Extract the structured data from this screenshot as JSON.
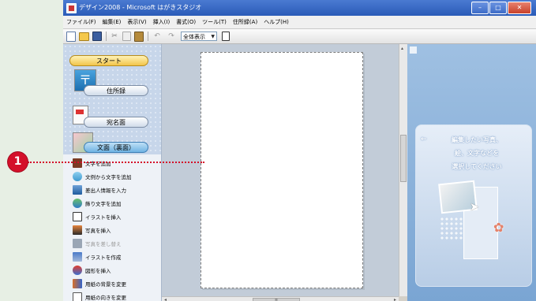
{
  "window": {
    "title": "デザイン2008 - Microsoft はがきスタジオ",
    "controls": {
      "minimize": "–",
      "maximize": "□",
      "close": "✕"
    }
  },
  "menubar": {
    "items": [
      "ファイル(F)",
      "編集(E)",
      "表示(V)",
      "挿入(I)",
      "書式(O)",
      "ツール(T)",
      "住所録(A)",
      "ヘルプ(H)"
    ]
  },
  "toolbar": {
    "zoom_value": "全体表示",
    "icons": [
      "new-icon",
      "open-icon",
      "save-icon",
      "cut-icon",
      "copy-icon",
      "paste-icon",
      "undo-icon",
      "redo-icon",
      "page-icon"
    ]
  },
  "sidebar": {
    "nav": {
      "start": "スタート",
      "address_book": "住所録",
      "recipient": "宛名面",
      "front": "文面（裏面）"
    },
    "tasks": [
      {
        "label": "文字を追加",
        "enabled": true
      },
      {
        "label": "文例から文字を追加",
        "enabled": true
      },
      {
        "label": "差出人情報を入力",
        "enabled": true
      },
      {
        "label": "飾り文字を追加",
        "enabled": true
      },
      {
        "label": "イラストを挿入",
        "enabled": true
      },
      {
        "label": "写真を挿入",
        "enabled": true
      },
      {
        "label": "写真を差し替え",
        "enabled": false
      },
      {
        "label": "イラストを作成",
        "enabled": true
      },
      {
        "label": "図形を挿入",
        "enabled": true
      },
      {
        "label": "用紙の背景を変更",
        "enabled": true
      },
      {
        "label": "用紙の向きを変更",
        "enabled": true
      }
    ]
  },
  "guide": {
    "arrow": "←",
    "line1": "編集したい写真、",
    "line2": "絵、文字などを",
    "line3": "選択してください"
  },
  "callout": {
    "number": "1"
  },
  "colors": {
    "callout": "#d4102a",
    "titlebar": "#2a5bb8",
    "workspace": "#c2ccd8",
    "guide_panel": "#7aa5d3"
  }
}
